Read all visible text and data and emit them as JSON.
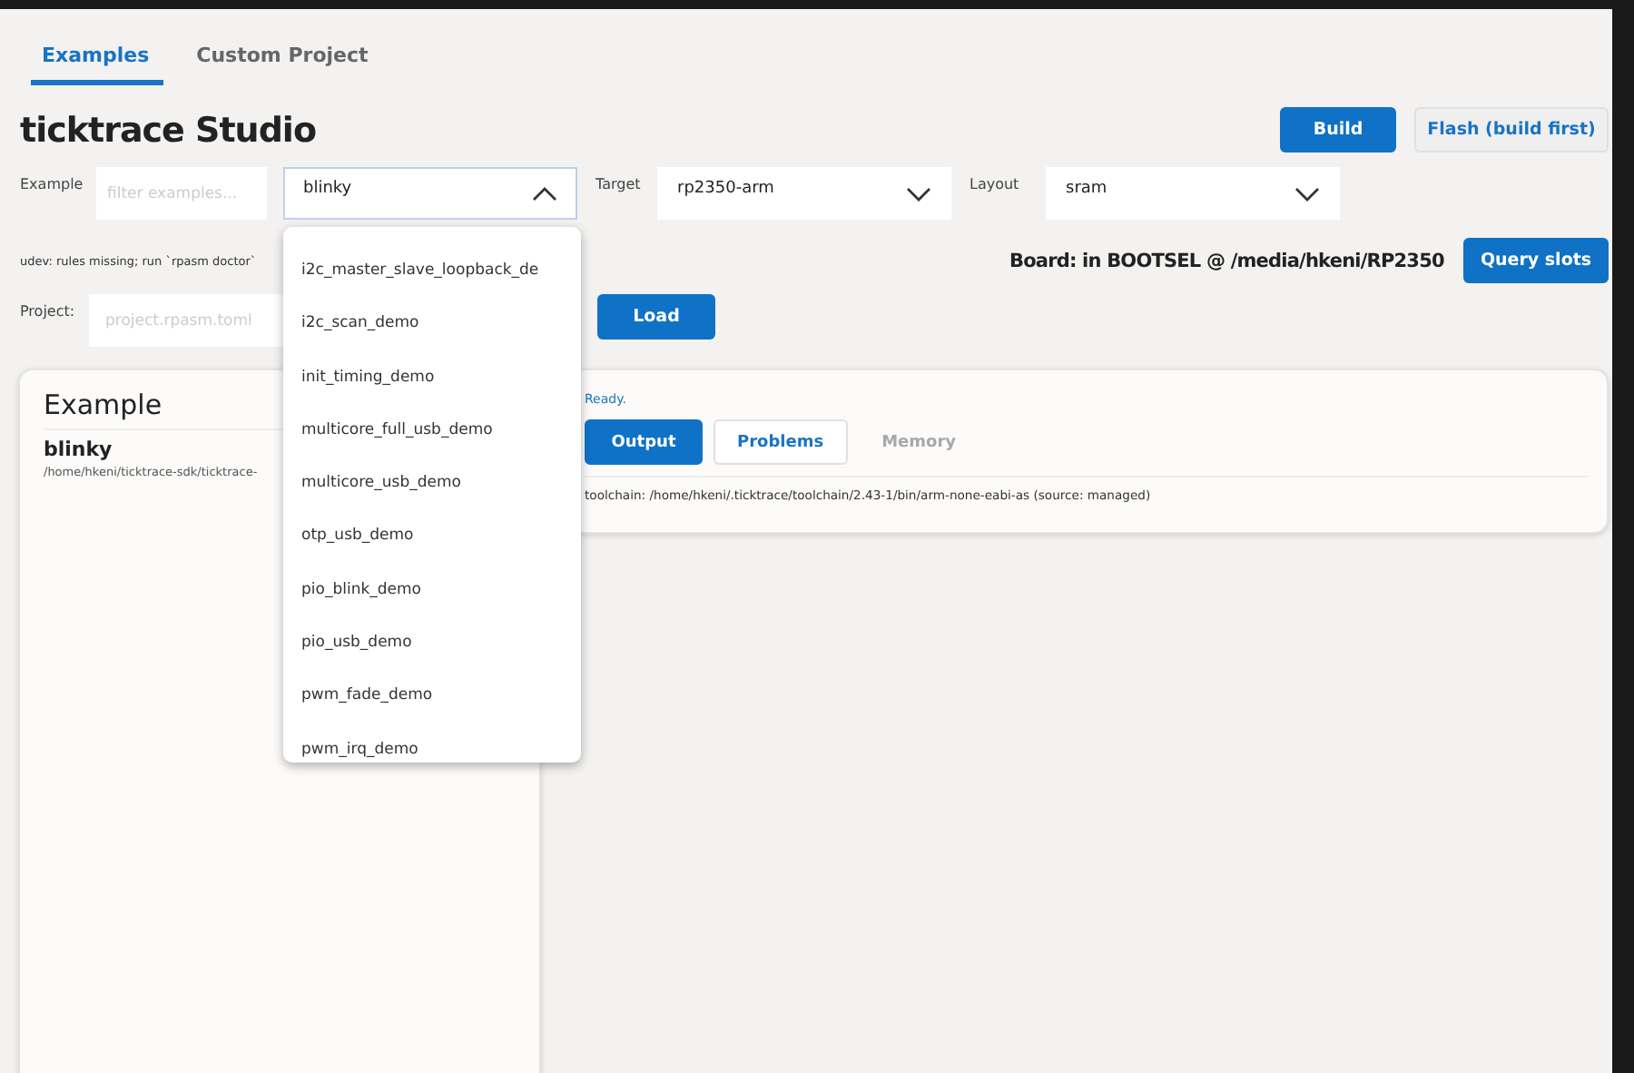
{
  "tabs": [
    {
      "label": "Examples",
      "selected": true
    },
    {
      "label": "Custom Project",
      "selected": false
    }
  ],
  "title": "ticktrace Studio",
  "header_buttons": [
    {
      "label": "Build",
      "kind": "primary"
    },
    {
      "label": "Flash (build first)",
      "kind": "secondary"
    }
  ],
  "example": {
    "label": "Example",
    "filter_placeholder": "filter examples...",
    "value": "blinky",
    "expanded": true
  },
  "target": {
    "label": "Target",
    "value": "rp2350-arm"
  },
  "layout": {
    "label": "Layout",
    "value": "sram"
  },
  "udev_message": "udev: rules missing; run `rpasm doctor`",
  "board_status": "Board: in BOOTSEL @ /media/hkeni/RP2350",
  "query_button": "Query slots",
  "project": {
    "label": "Project:",
    "placeholder": "project.rpasm.toml",
    "load_button": "Load"
  },
  "example_card": {
    "heading": "Example",
    "name": "blinky",
    "path": "/home/hkeni/ticktrace-sdk/ticktrace-"
  },
  "output_card": {
    "status": "Ready.",
    "tabs": [
      {
        "label": "Output",
        "selected": true,
        "disabled": false
      },
      {
        "label": "Problems",
        "selected": false,
        "disabled": false
      },
      {
        "label": "Memory",
        "selected": false,
        "disabled": true
      }
    ],
    "log": "toolchain: /home/hkeni/.ticktrace/toolchain/2.43-1/bin/arm-none-eabi-as  (source: managed)"
  },
  "dropdown_options": [
    "i2c_master_slave_loopback_de",
    "i2c_scan_demo",
    "init_timing_demo",
    "multicore_full_usb_demo",
    "multicore_usb_demo",
    "otp_usb_demo",
    "pio_blink_demo",
    "pio_usb_demo",
    "pwm_fade_demo",
    "pwm_irq_demo"
  ]
}
